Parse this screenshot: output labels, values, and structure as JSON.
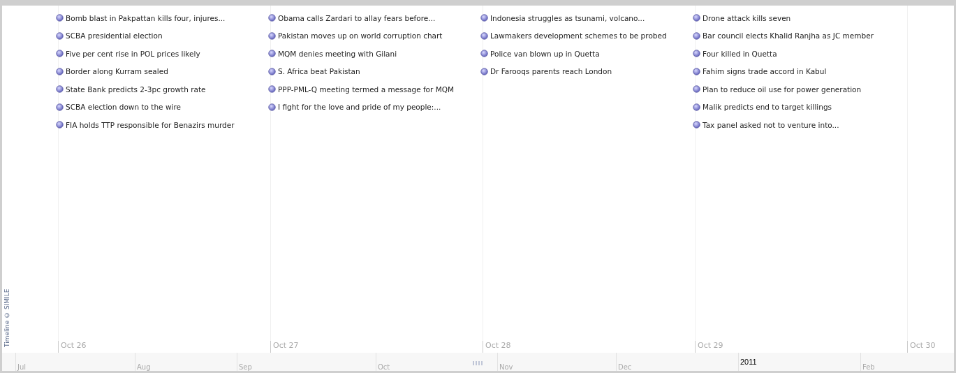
{
  "credit": "Timeline © SIMILE",
  "days": [
    {
      "label": "Oct 26",
      "events": [
        "Bomb blast in Pakpattan kills four, injures...",
        "SCBA presidential election",
        "Five per cent rise in POL prices likely",
        "Border along Kurram sealed",
        "State Bank predicts 2-3pc growth rate",
        "SCBA election down to the wire",
        "FIA holds TTP responsible for Benazirs murder"
      ]
    },
    {
      "label": "Oct 27",
      "events": [
        "Obama calls Zardari to allay fears before...",
        "Pakistan moves up on world corruption chart",
        "MQM denies meeting with Gilani",
        "S. Africa beat Pakistan",
        "PPP-PML-Q meeting termed a message for MQM",
        "I fight for the love and pride of my people:..."
      ]
    },
    {
      "label": "Oct 28",
      "events": [
        "Indonesia struggles as tsunami, volcano...",
        "Lawmakers development schemes to be probed",
        "Police van blown up in Quetta",
        "Dr Farooqs parents reach London"
      ]
    },
    {
      "label": "Oct 29",
      "events": [
        "Drone attack kills seven",
        "Bar council elects Khalid Ranjha as JC member",
        "Four killed in Quetta",
        "Fahim signs trade accord in Kabul",
        "Plan to reduce oil use for power generation",
        "Malik predicts end to target killings",
        "Tax panel asked not to venture into..."
      ]
    },
    {
      "label": "Oct 30"
    }
  ],
  "overview": [
    {
      "label": "Jul",
      "kind": "month"
    },
    {
      "label": "Aug",
      "kind": "month"
    },
    {
      "label": "Sep",
      "kind": "month"
    },
    {
      "label": "Oct",
      "kind": "month"
    },
    {
      "label": "Nov",
      "kind": "month"
    },
    {
      "label": "Dec",
      "kind": "month"
    },
    {
      "label": "2011",
      "kind": "year"
    },
    {
      "label": "Feb",
      "kind": "month"
    }
  ]
}
